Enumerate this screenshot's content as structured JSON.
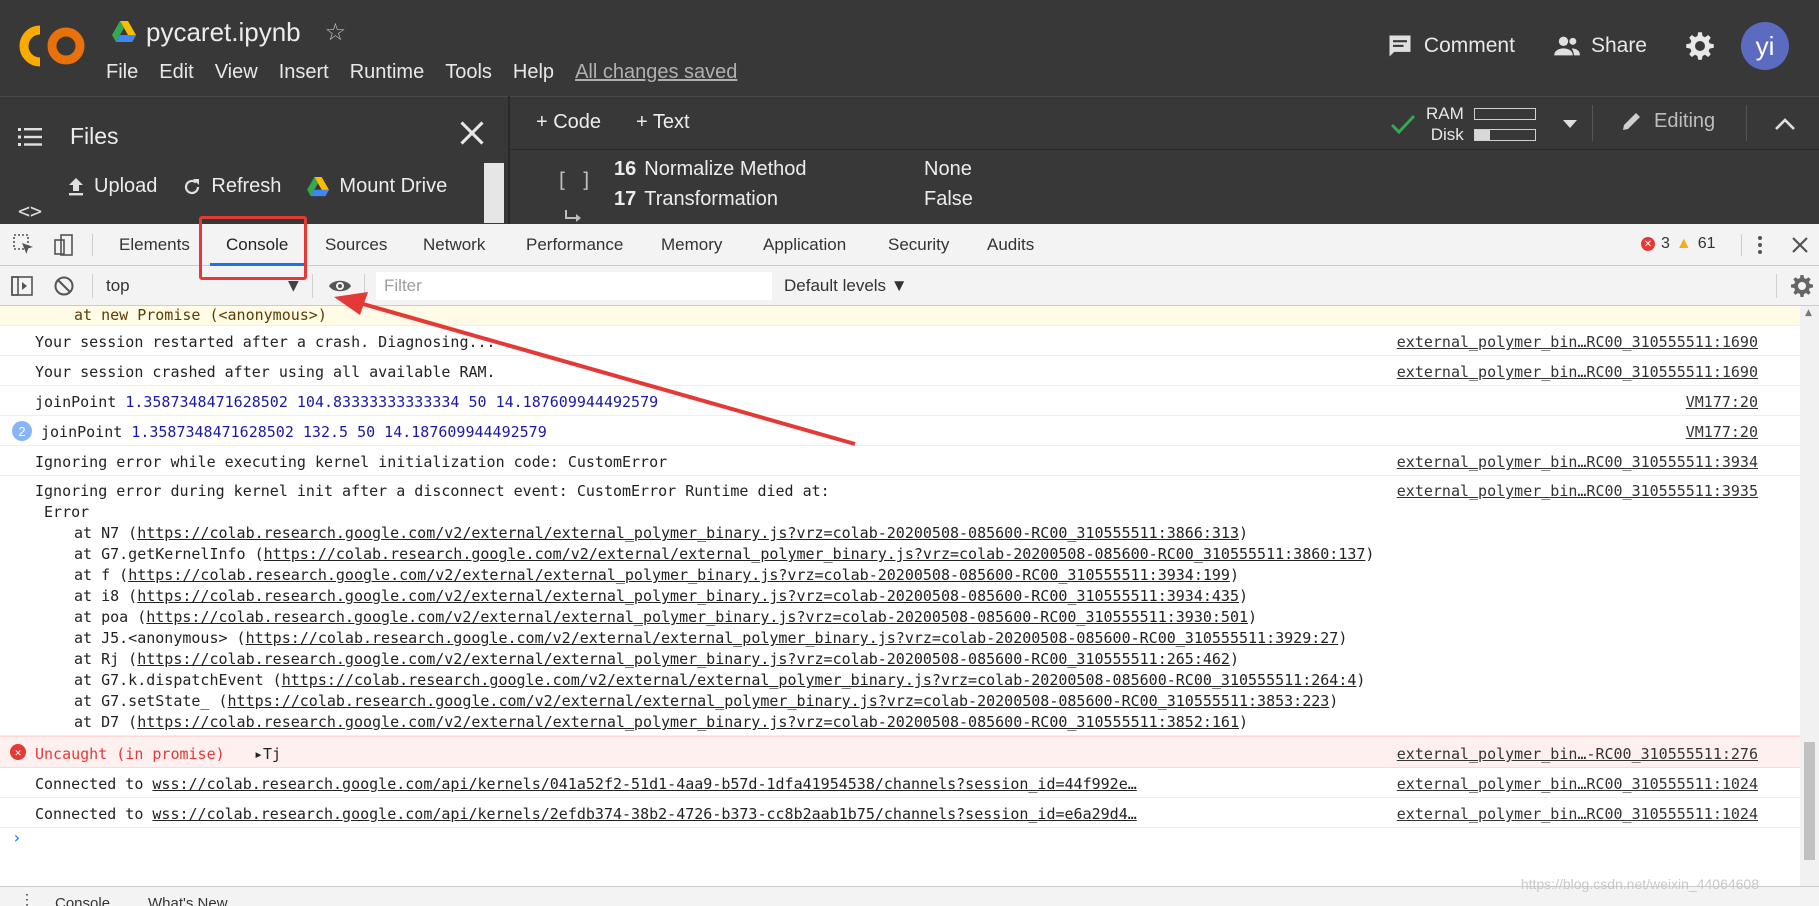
{
  "header": {
    "doc_title": "pycaret.ipynb",
    "menu": [
      "File",
      "Edit",
      "View",
      "Insert",
      "Runtime",
      "Tools",
      "Help"
    ],
    "save_status": "All changes saved",
    "comment_label": "Comment",
    "share_label": "Share",
    "avatar_initials": "yi"
  },
  "files_panel": {
    "title": "Files",
    "upload_label": "Upload",
    "refresh_label": "Refresh",
    "mount_label": "Mount Drive"
  },
  "notebook": {
    "add_code_label": "+ Code",
    "add_text_label": "+ Text",
    "ram_label": "RAM",
    "disk_label": "Disk",
    "ram_usage": 0.0,
    "disk_usage": 0.25,
    "editing_label": "Editing",
    "cell_bracket": "[ ]",
    "output_rows": [
      {
        "index": "16",
        "name": "Normalize Method",
        "value": "None"
      },
      {
        "index": "17",
        "name": "Transformation",
        "value": "False"
      }
    ]
  },
  "devtools": {
    "tabs": [
      "Elements",
      "Console",
      "Sources",
      "Network",
      "Performance",
      "Memory",
      "Application",
      "Security",
      "Audits"
    ],
    "active_tab": "Console",
    "error_count": "3",
    "warning_count": "61",
    "context": "top",
    "filter_placeholder": "Filter",
    "levels_label": "Default levels ▼",
    "drawer_tabs": [
      "Console",
      "What's New"
    ]
  },
  "console": {
    "warn_tail": "at new Promise (<anonymous>)",
    "rows": [
      {
        "msg": "Your session restarted after a crash. Diagnosing...",
        "src": "external_polymer_bin…RC00_310555511:1690"
      },
      {
        "msg": "Your session crashed after using all available RAM.",
        "src": "external_polymer_bin…RC00_310555511:1690"
      },
      {
        "prefix": "joinPoint",
        "nums": "1.3587348471628502 104.83333333333334 50 14.187609944492579",
        "src": "VM177:20"
      },
      {
        "repeat": "2",
        "prefix": "joinPoint",
        "nums": "1.3587348471628502 132.5 50 14.187609944492579",
        "src": "VM177:20"
      },
      {
        "msg": "Ignoring error while executing kernel initialization code: CustomError",
        "src": "external_polymer_bin…RC00_310555511:3934"
      }
    ],
    "stack_header": "Ignoring error during kernel init after a disconnect event: CustomError Runtime died at:",
    "stack_src": "external_polymer_bin…RC00_310555511:3935",
    "stack_error": " Error",
    "stack": [
      {
        "fn": "at N7 (",
        "url": "https://colab.research.google.com/v2/external/external_polymer_binary.js?vrz=colab-20200508-085600-RC00_310555511:3866:313",
        "end": ")"
      },
      {
        "fn": "at G7.getKernelInfo (",
        "url": "https://colab.research.google.com/v2/external/external_polymer_binary.js?vrz=colab-20200508-085600-RC00_310555511:3860:137",
        "end": ")"
      },
      {
        "fn": "at f (",
        "url": "https://colab.research.google.com/v2/external/external_polymer_binary.js?vrz=colab-20200508-085600-RC00_310555511:3934:199",
        "end": ")"
      },
      {
        "fn": "at i8 (",
        "url": "https://colab.research.google.com/v2/external/external_polymer_binary.js?vrz=colab-20200508-085600-RC00_310555511:3934:435",
        "end": ")"
      },
      {
        "fn": "at poa (",
        "url": "https://colab.research.google.com/v2/external/external_polymer_binary.js?vrz=colab-20200508-085600-RC00_310555511:3930:501",
        "end": ")"
      },
      {
        "fn": "at J5.<anonymous> (",
        "url": "https://colab.research.google.com/v2/external/external_polymer_binary.js?vrz=colab-20200508-085600-RC00_310555511:3929:27",
        "end": ")"
      },
      {
        "fn": "at Rj (",
        "url": "https://colab.research.google.com/v2/external/external_polymer_binary.js?vrz=colab-20200508-085600-RC00_310555511:265:462",
        "end": ")"
      },
      {
        "fn": "at G7.k.dispatchEvent (",
        "url": "https://colab.research.google.com/v2/external/external_polymer_binary.js?vrz=colab-20200508-085600-RC00_310555511:264:4",
        "end": ")"
      },
      {
        "fn": "at G7.setState_ (",
        "url": "https://colab.research.google.com/v2/external/external_polymer_binary.js?vrz=colab-20200508-085600-RC00_310555511:3853:223",
        "end": ")"
      },
      {
        "fn": "at D7 (",
        "url": "https://colab.research.google.com/v2/external/external_polymer_binary.js?vrz=colab-20200508-085600-RC00_310555511:3852:161",
        "end": ")"
      }
    ],
    "uncaught_msg": "Uncaught (in promise)",
    "uncaught_obj": "Tj",
    "uncaught_src": "external_polymer_bin…-RC00_310555511:276",
    "connected": [
      {
        "prefix": "Connected to ",
        "url": "wss://colab.research.google.com/api/kernels/041a52f2-51d1-4aa9-b57d-1dfa41954538/channels?session_id=44f992e…",
        "src": "external_polymer_bin…RC00_310555511:1024"
      },
      {
        "prefix": "Connected to ",
        "url": "wss://colab.research.google.com/api/kernels/2efdb374-38b2-4726-b373-cc8b2aab1b75/channels?session_id=e6a29d4…",
        "src": "external_polymer_bin…RC00_310555511:1024"
      }
    ]
  },
  "watermark": "https://blog.csdn.net/weixin_44064608",
  "colors": {
    "colab_bg": "#383838",
    "accent_blue": "#1a73e8",
    "annotation_red": "#e53935",
    "colab_orange": "#f9ab00"
  }
}
